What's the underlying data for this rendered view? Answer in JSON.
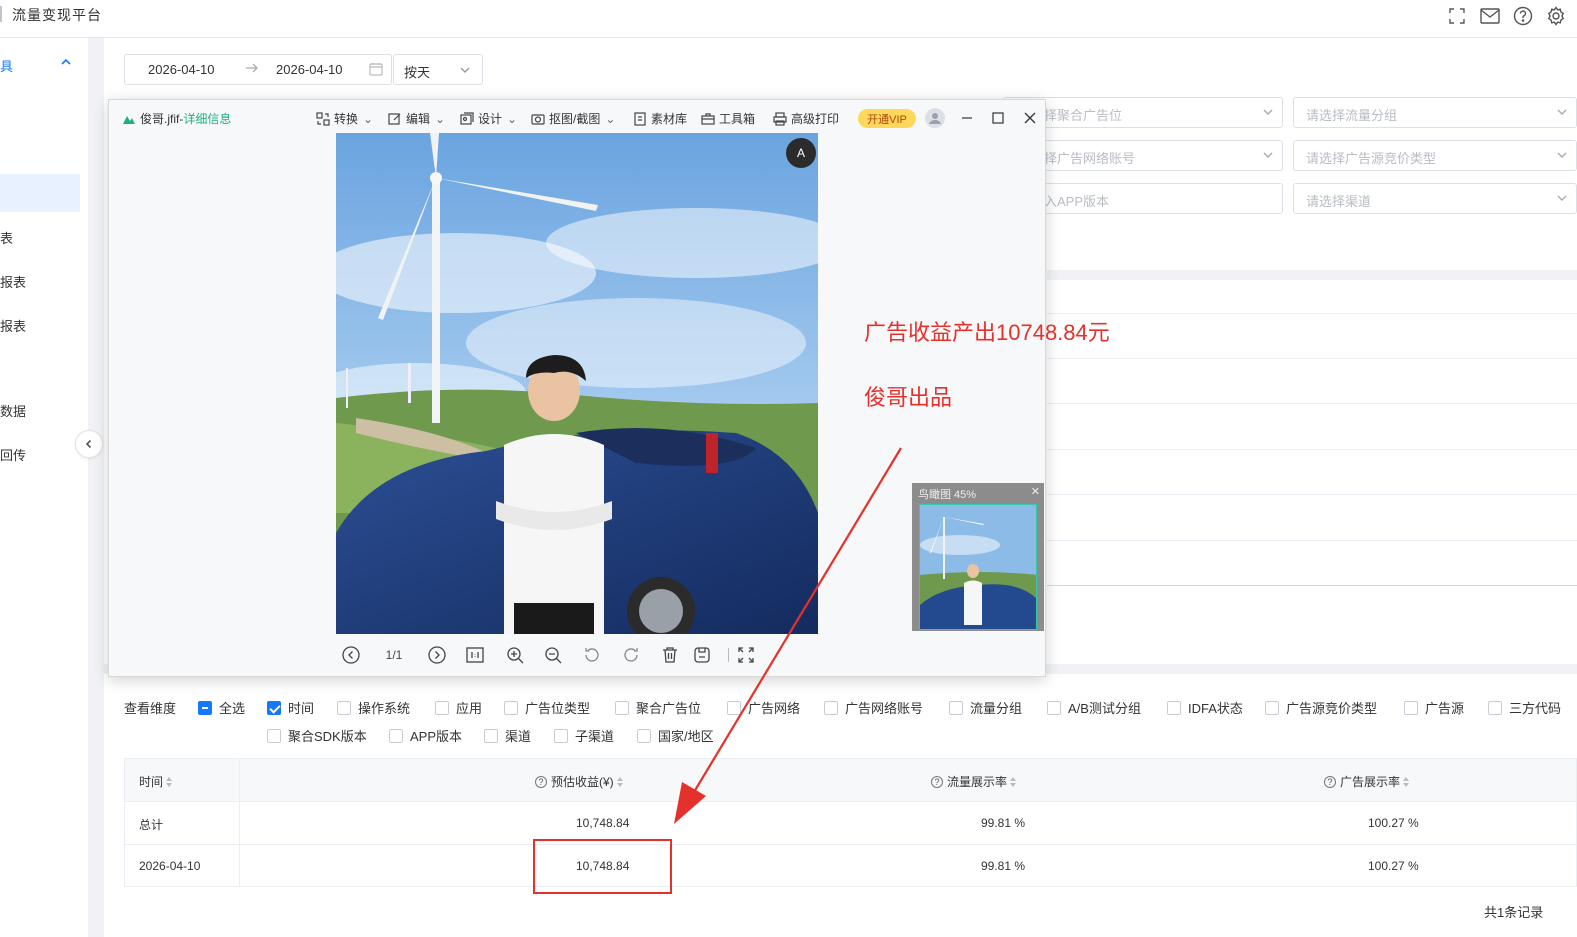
{
  "app": {
    "title": "流量变现平台"
  },
  "sidebar": {
    "items": [
      "具",
      "表",
      "报表",
      "报表",
      "数据",
      "回传"
    ]
  },
  "filters": {
    "date_start": "2026-04-10",
    "date_end": "2026-04-10",
    "period": "按天",
    "selects": [
      "择聚合广告位",
      "请选择流量分组",
      "择广告网络账号",
      "请选择广告源竞价类型",
      "入APP版本",
      "请选择渠道"
    ]
  },
  "viewer": {
    "filename": "俊哥.jfif",
    "separator": " - ",
    "detail": "详细信息",
    "tools": [
      "转换",
      "编辑",
      "设计",
      "抠图/截图",
      "素材库",
      "工具箱",
      "高级打印"
    ],
    "vip": "开通VIP",
    "page_indicator": "1/1",
    "ocr_label": "A",
    "thumbnail_title": "鸟瞰图 45%"
  },
  "annotations": {
    "revenue_note": "广告收益产出10748.84元",
    "credit": "俊哥出品"
  },
  "dimensions": {
    "label": "查看维度",
    "items": [
      {
        "label": "全选",
        "state": "indeterminate"
      },
      {
        "label": "时间",
        "state": "checked"
      },
      {
        "label": "操作系统",
        "state": "unchecked"
      },
      {
        "label": "应用",
        "state": "unchecked"
      },
      {
        "label": "广告位类型",
        "state": "unchecked"
      },
      {
        "label": "聚合广告位",
        "state": "unchecked"
      },
      {
        "label": "广告网络",
        "state": "unchecked"
      },
      {
        "label": "广告网络账号",
        "state": "unchecked"
      },
      {
        "label": "流量分组",
        "state": "unchecked"
      },
      {
        "label": "A/B测试分组",
        "state": "unchecked"
      },
      {
        "label": "IDFA状态",
        "state": "unchecked"
      },
      {
        "label": "广告源竞价类型",
        "state": "unchecked"
      },
      {
        "label": "广告源",
        "state": "unchecked"
      },
      {
        "label": "三方代码",
        "state": "unchecked"
      },
      {
        "label": "聚合SDK版本",
        "state": "unchecked"
      },
      {
        "label": "APP版本",
        "state": "unchecked"
      },
      {
        "label": "渠道",
        "state": "unchecked"
      },
      {
        "label": "子渠道",
        "state": "unchecked"
      },
      {
        "label": "国家/地区",
        "state": "unchecked"
      }
    ]
  },
  "table": {
    "headers": [
      "时间",
      "预估收益(¥)",
      "流量展示率",
      "广告展示率"
    ],
    "rows": [
      [
        "总计",
        "10,748.84",
        "99.81 %",
        "100.27 %"
      ],
      [
        "2026-04-10",
        "10,748.84",
        "99.81 %",
        "100.27 %"
      ]
    ]
  },
  "pagination": {
    "total_text": "共1条记录"
  },
  "colors": {
    "accent": "#1677ff",
    "annotation": "#e5312c",
    "vip": "#ffd75a"
  }
}
